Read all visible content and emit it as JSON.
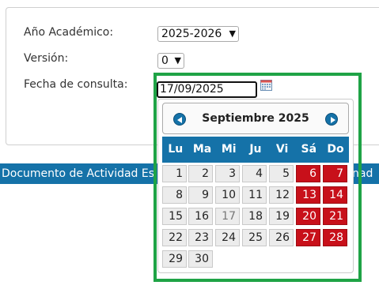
{
  "form": {
    "academic_year_label": "Año Académico:",
    "academic_year_value": "2025-2026",
    "version_label": "Versión:",
    "version_value": "0",
    "date_label": "Fecha de consulta:",
    "date_value": "17/09/2025"
  },
  "bar": {
    "left_text": "Documento de Actividad Es",
    "right_text": "nad"
  },
  "datepicker": {
    "month_title": "Septiembre 2025",
    "weekdays": [
      "Lu",
      "Ma",
      "Mi",
      "Ju",
      "Vi",
      "Sá",
      "Do"
    ],
    "weeks": [
      [
        "1",
        "2",
        "3",
        "4",
        "5",
        "6",
        "7"
      ],
      [
        "8",
        "9",
        "10",
        "11",
        "12",
        "13",
        "14"
      ],
      [
        "15",
        "16",
        "17",
        "18",
        "19",
        "20",
        "21"
      ],
      [
        "22",
        "23",
        "24",
        "25",
        "26",
        "27",
        "28"
      ],
      [
        "29",
        "30",
        "",
        "",
        "",
        "",
        ""
      ]
    ],
    "today": "17",
    "weekend_color": "#c8101a",
    "header_color": "#1572a8"
  },
  "highlight_color": "#1fa346"
}
